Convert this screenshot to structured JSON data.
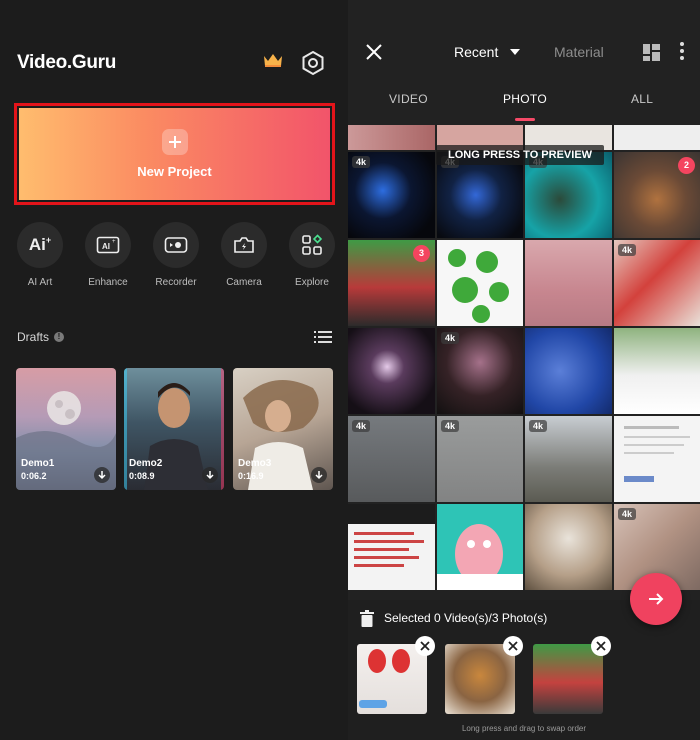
{
  "home": {
    "brand": "Video.Guru",
    "new_project_label": "New Project",
    "tools": [
      {
        "label": "AI Art",
        "icon": "ai-art-icon"
      },
      {
        "label": "Enhance",
        "icon": "enhance-icon"
      },
      {
        "label": "Recorder",
        "icon": "recorder-icon"
      },
      {
        "label": "Camera",
        "icon": "camera-icon"
      },
      {
        "label": "Explore",
        "icon": "explore-icon"
      }
    ],
    "drafts_title": "Drafts",
    "drafts": [
      {
        "name": "Demo1",
        "duration": "0:06.2"
      },
      {
        "name": "Demo2",
        "duration": "0:08.9"
      },
      {
        "name": "Demo3",
        "duration": "0:16.9"
      }
    ]
  },
  "picker": {
    "album_label": "Recent",
    "material_label": "Material",
    "tabs": [
      {
        "label": "VIDEO"
      },
      {
        "label": "PHOTO",
        "active": true
      },
      {
        "label": "ALL"
      }
    ],
    "hint_text": "LONG PRESS TO PREVIEW",
    "chip_text": "4k",
    "badges": [
      "2",
      "3"
    ],
    "selected_text": "Selected 0 Video(s)/3 Photo(s)",
    "swap_hint": "Long press and drag to swap order"
  },
  "colors": {
    "accent": "#f0425f",
    "highlight_border": "#e3141a",
    "gradient_start": "#ffbd6e",
    "gradient_end": "#f2546a"
  }
}
